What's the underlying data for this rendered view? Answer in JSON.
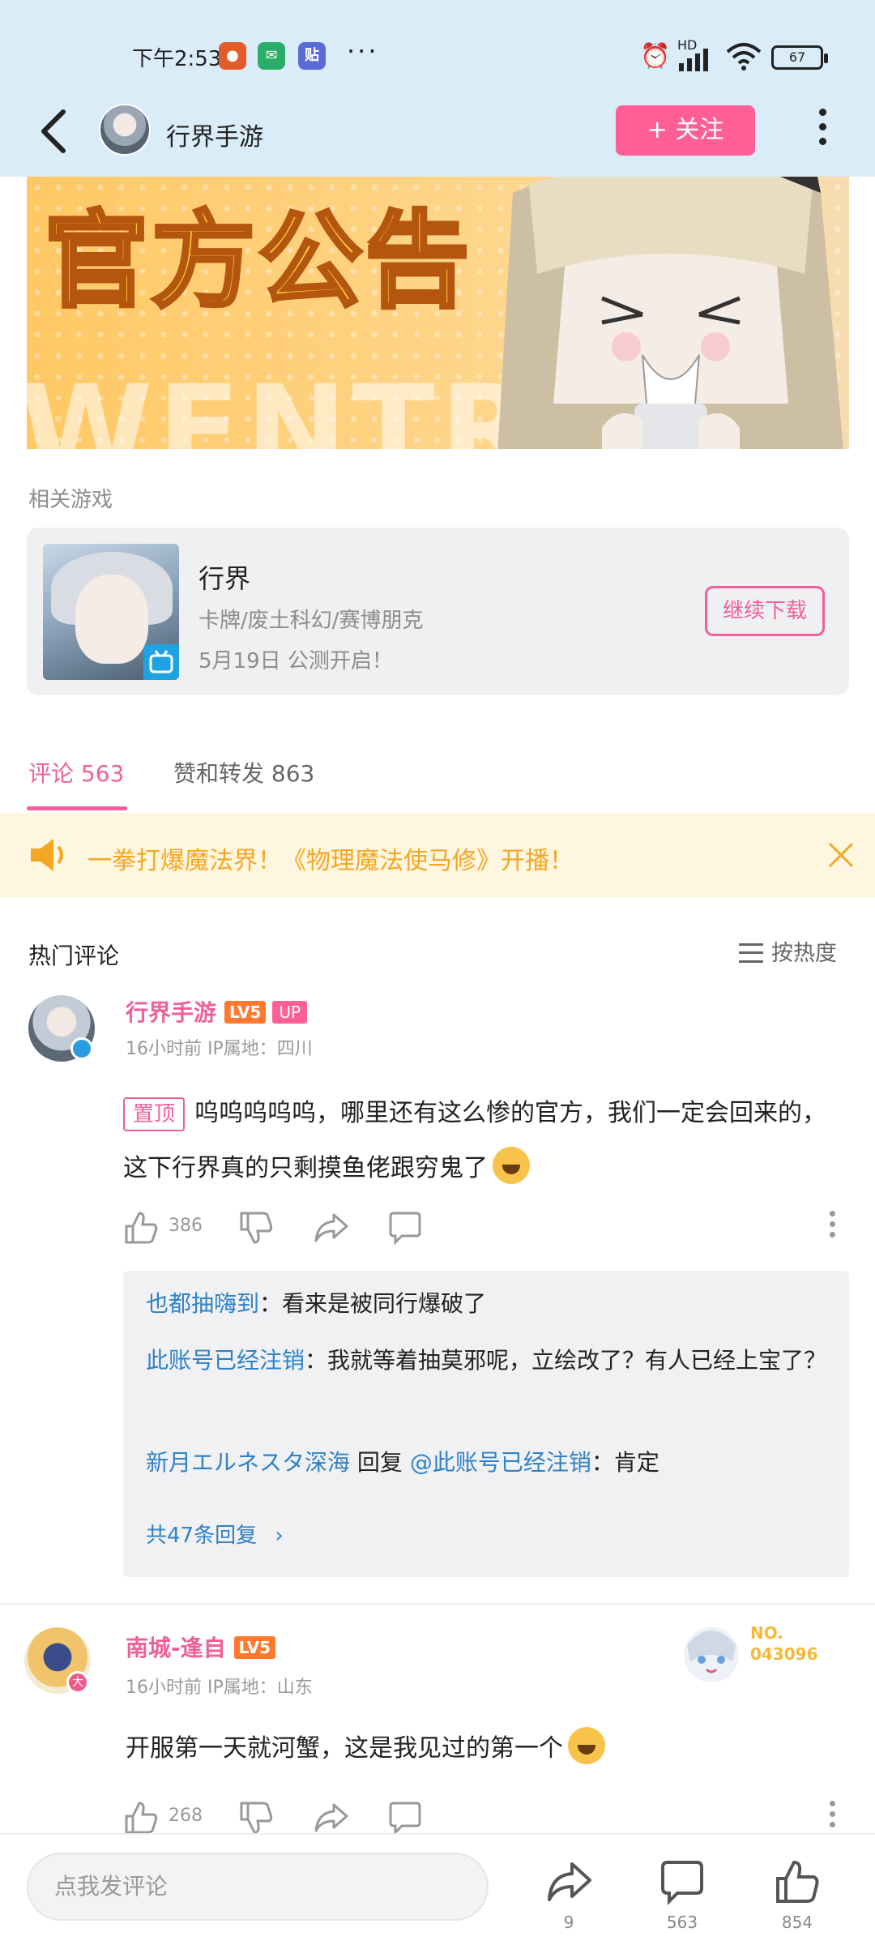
{
  "status": {
    "time": "下午2:53",
    "battery": "67",
    "signal_label": "HD"
  },
  "header": {
    "username": "行界手游",
    "follow_label": "+ 关注"
  },
  "banner": {
    "title": "官方公告",
    "watermark": "WENTRI"
  },
  "related": {
    "label": "相关游戏",
    "game_name": "行界",
    "game_tags": "卡牌/废土科幻/赛博朋克",
    "game_desc": "5月19日 公测开启！",
    "button_label": "继续下载"
  },
  "tabs": [
    {
      "label": "评论 563"
    },
    {
      "label": "赞和转发 863"
    }
  ],
  "notice": {
    "text": "一拳打爆魔法界！《物理魔法使马修》开播！"
  },
  "comments_header": {
    "title": "热门评论",
    "sort_label": "按热度"
  },
  "comments": [
    {
      "name": "行界手游",
      "level": "LV5",
      "up_badge": "UP",
      "meta": "16小时前  IP属地：四川",
      "pin_label": "置顶",
      "text": "呜呜呜呜呜，哪里还有这么惨的官方，我们一定会回来的，这下行界真的只剩摸鱼佬跟穷鬼了",
      "likes": "386",
      "replies": [
        {
          "name": "也都抽嗨到",
          "text": "：看来是被同行爆破了"
        },
        {
          "name": "此账号已经注销",
          "text": "：我就等着抽莫邪呢，立绘改了？有人已经上宝了？"
        },
        {
          "name": "新月エルネスタ深海",
          "reply_word": " 回复 ",
          "target": "@此账号已经注销",
          "text": "：肯定"
        }
      ],
      "more_replies": "共47条回复"
    },
    {
      "name": "南城-逢自",
      "level": "LV5",
      "meta": "16小时前  IP属地：山东",
      "text": "开服第一天就河蟹，这是我见过的第一个",
      "likes": "268",
      "fan_badge_label": "NO.",
      "fan_badge_number": "043096"
    }
  ],
  "bottom": {
    "input_placeholder": "点我发评论",
    "share_count": "9",
    "comment_count": "563",
    "like_count": "854"
  }
}
